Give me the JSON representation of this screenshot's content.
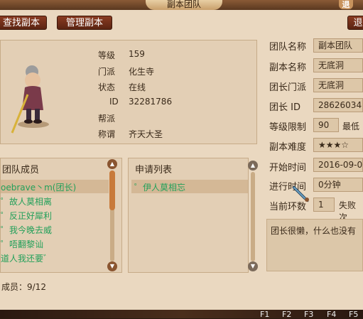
{
  "window": {
    "title": "副本团队",
    "close_label": "退"
  },
  "tabs": {
    "find": "查找副本",
    "manage": "管理副本",
    "back": "退"
  },
  "character": {
    "labels": [
      "等级",
      "门派",
      "状态",
      "ID",
      "帮派",
      "称谓"
    ],
    "values": [
      "159",
      "化生寺",
      "在线",
      "32281786",
      "",
      "齐天大圣"
    ]
  },
  "team_members": {
    "header": "团队成员",
    "items": [
      "oebrave丶m(团长)",
      "゜故人莫相离",
      "゜反正好犀利",
      "゜我今晚去威",
      "゜唔翻黎讪",
      "道人我还要゛"
    ],
    "count_label": "成员：9/12"
  },
  "applications": {
    "header": "申请列表",
    "items": [
      "゜伊人莫相忘"
    ]
  },
  "team_info": {
    "labels": {
      "team_name": "团队名称",
      "dungeon_name": "副本名称",
      "leader_school": "团长门派",
      "leader_id": "团长 ID",
      "level_limit": "等级限制",
      "difficulty": "副本难度",
      "start_time": "开始时间",
      "elapsed": "进行时间",
      "current_ring": "当前环数"
    },
    "values": {
      "team_name": "副本团队",
      "dungeon_name": "无底洞",
      "leader_school": "无底洞",
      "leader_id": "28626034",
      "level_limit": "90",
      "level_limit_suffix": "最低",
      "difficulty": "★★★☆",
      "start_time": "2016-09-0",
      "elapsed": "0分钟",
      "current_ring": "1",
      "fail_label": "失败次"
    },
    "notice": "团长很懒，什么也没有"
  },
  "hotkeys": [
    "F1",
    "F2",
    "F3",
    "F4",
    "F5"
  ]
}
